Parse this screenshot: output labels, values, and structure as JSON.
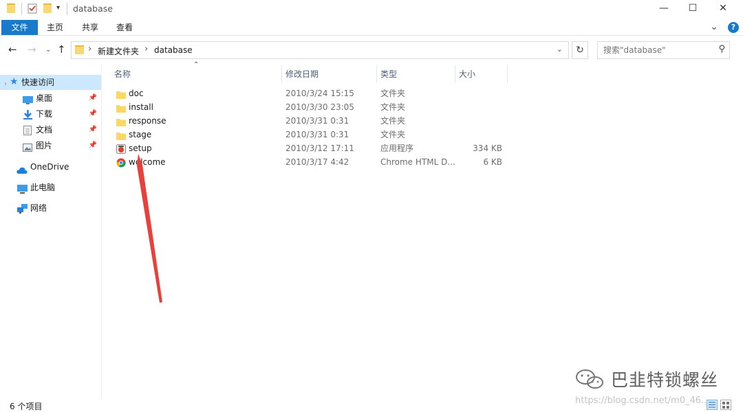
{
  "window": {
    "title": "database",
    "minimize": "—",
    "maximize": "☐",
    "close": "✕"
  },
  "ribbon": {
    "tabs": [
      "文件",
      "主页",
      "共享",
      "查看"
    ],
    "expand": "⌄",
    "help": "?"
  },
  "address": {
    "crumbs": [
      "新建文件夹",
      "database"
    ],
    "separator": "›",
    "dropdown": "⌄",
    "refresh": "↻"
  },
  "search": {
    "placeholder": "搜索\"database\""
  },
  "sidebar": {
    "items": [
      {
        "label": "快速访问",
        "icon": "star-icon",
        "pinned": false
      },
      {
        "label": "桌面",
        "icon": "desktop-icon",
        "pinned": true
      },
      {
        "label": "下载",
        "icon": "download-icon",
        "pinned": true
      },
      {
        "label": "文档",
        "icon": "document-icon",
        "pinned": true
      },
      {
        "label": "图片",
        "icon": "picture-icon",
        "pinned": true
      },
      {
        "label": "OneDrive",
        "icon": "cloud-icon",
        "pinned": false
      },
      {
        "label": "此电脑",
        "icon": "computer-icon",
        "pinned": false
      },
      {
        "label": "网络",
        "icon": "network-icon",
        "pinned": false
      }
    ]
  },
  "columns": {
    "name": "名称",
    "date": "修改日期",
    "type": "类型",
    "size": "大小"
  },
  "files": [
    {
      "name": "doc",
      "date": "2010/3/24 15:15",
      "type": "文件夹",
      "size": "",
      "icon": "folder-icon"
    },
    {
      "name": "install",
      "date": "2010/3/30 23:05",
      "type": "文件夹",
      "size": "",
      "icon": "folder-icon"
    },
    {
      "name": "response",
      "date": "2010/3/31 0:31",
      "type": "文件夹",
      "size": "",
      "icon": "folder-icon"
    },
    {
      "name": "stage",
      "date": "2010/3/31 0:31",
      "type": "文件夹",
      "size": "",
      "icon": "folder-icon"
    },
    {
      "name": "setup",
      "date": "2010/3/12 17:11",
      "type": "应用程序",
      "size": "334 KB",
      "icon": "application-icon"
    },
    {
      "name": "welcome",
      "date": "2010/3/17 4:42",
      "type": "Chrome HTML D...",
      "size": "6 KB",
      "icon": "chrome-icon"
    }
  ],
  "status": {
    "count": "6 个项目"
  },
  "watermark": {
    "brand": "巴韭特锁螺丝",
    "url": "https://blog.csdn.net/m0_46..."
  },
  "colors": {
    "accent": "#1979ca",
    "selection": "#cce8ff",
    "folder": "#f8d775",
    "annotation_arrow": "#e8403a"
  }
}
